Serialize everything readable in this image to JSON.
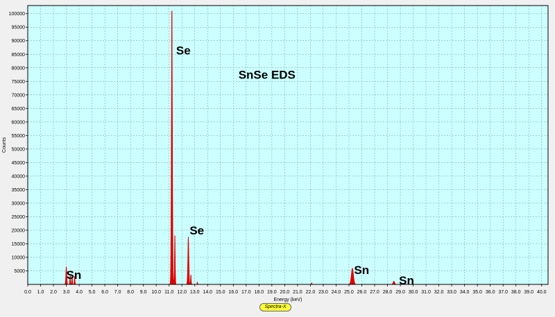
{
  "chart_data": {
    "type": "area",
    "xlabel": "Energy (keV)",
    "ylabel": "Counts",
    "xlim": [
      0,
      40.5
    ],
    "ylim": [
      0,
      103000
    ],
    "grid": true,
    "plot_background": "#ccffff",
    "fill_color": "#e00000",
    "x_ticks": [
      0,
      1,
      2,
      3,
      4,
      5,
      6,
      7,
      8,
      9,
      10,
      11,
      12,
      13,
      14,
      15,
      16,
      17,
      18,
      19,
      20,
      21,
      22,
      23,
      24,
      25,
      26,
      27,
      28,
      29,
      30,
      31,
      32,
      33,
      34,
      35,
      36,
      37,
      38,
      39,
      40
    ],
    "x_tick_labels": [
      "0.0",
      "1.0",
      "2.0",
      "3.0",
      "4.0",
      "5.0",
      "6.0",
      "7.0",
      "8.0",
      "9.0",
      "10.0",
      "11.0",
      "12.0",
      "13.0",
      "14.0",
      "15.0",
      "16.0",
      "17.0",
      "18.0",
      "19.0",
      "20.0",
      "21.0",
      "22.0",
      "23.0",
      "24.0",
      "25.0",
      "26.0",
      "27.0",
      "28.0",
      "29.0",
      "30.0",
      "31.0",
      "32.0",
      "33.0",
      "34.0",
      "35.0",
      "36.0",
      "37.0",
      "38.0",
      "39.0",
      "40.0"
    ],
    "y_ticks": [
      5000,
      10000,
      15000,
      20000,
      25000,
      30000,
      35000,
      40000,
      45000,
      50000,
      55000,
      60000,
      65000,
      70000,
      75000,
      80000,
      85000,
      90000,
      95000,
      100000
    ],
    "y_tick_labels": [
      "5000",
      "10000",
      "15000",
      "20000",
      "25000",
      "30000",
      "35000",
      "40000",
      "45000",
      "50000",
      "55000",
      "60000",
      "65000",
      "70000",
      "75000",
      "80000",
      "85000",
      "90000",
      "95000",
      "100000"
    ],
    "series": [
      {
        "peaks": [
          {
            "x": 3.0,
            "y": 6500,
            "width": 0.09
          },
          {
            "x": 3.3,
            "y": 3800,
            "width": 0.06
          },
          {
            "x": 3.45,
            "y": 3500,
            "width": 0.06
          },
          {
            "x": 3.65,
            "y": 3000,
            "width": 0.07
          },
          {
            "x": 11.22,
            "y": 101000,
            "width": 0.1
          },
          {
            "x": 11.45,
            "y": 18000,
            "width": 0.07
          },
          {
            "x": 12.5,
            "y": 17500,
            "width": 0.1
          },
          {
            "x": 12.7,
            "y": 3500,
            "width": 0.06
          },
          {
            "x": 13.2,
            "y": 900,
            "width": 0.05
          },
          {
            "x": 22.1,
            "y": 600,
            "width": 0.05
          },
          {
            "x": 25.27,
            "y": 6000,
            "width": 0.2
          },
          {
            "x": 28.5,
            "y": 1200,
            "width": 0.15
          }
        ]
      }
    ],
    "annotations": [
      {
        "text": "Se",
        "x": 11.55,
        "y": 85000
      },
      {
        "text": "SnSe  EDS",
        "x": 16.4,
        "y": 76000
      },
      {
        "text": "Se",
        "x": 12.6,
        "y": 18500
      },
      {
        "text": "Sn",
        "x": 3.0,
        "y": 2000
      },
      {
        "text": "Sn",
        "x": 25.4,
        "y": 3800
      },
      {
        "text": "Sn",
        "x": 28.9,
        "y": 0
      }
    ]
  },
  "logo": {
    "text": "Spectra-X"
  }
}
